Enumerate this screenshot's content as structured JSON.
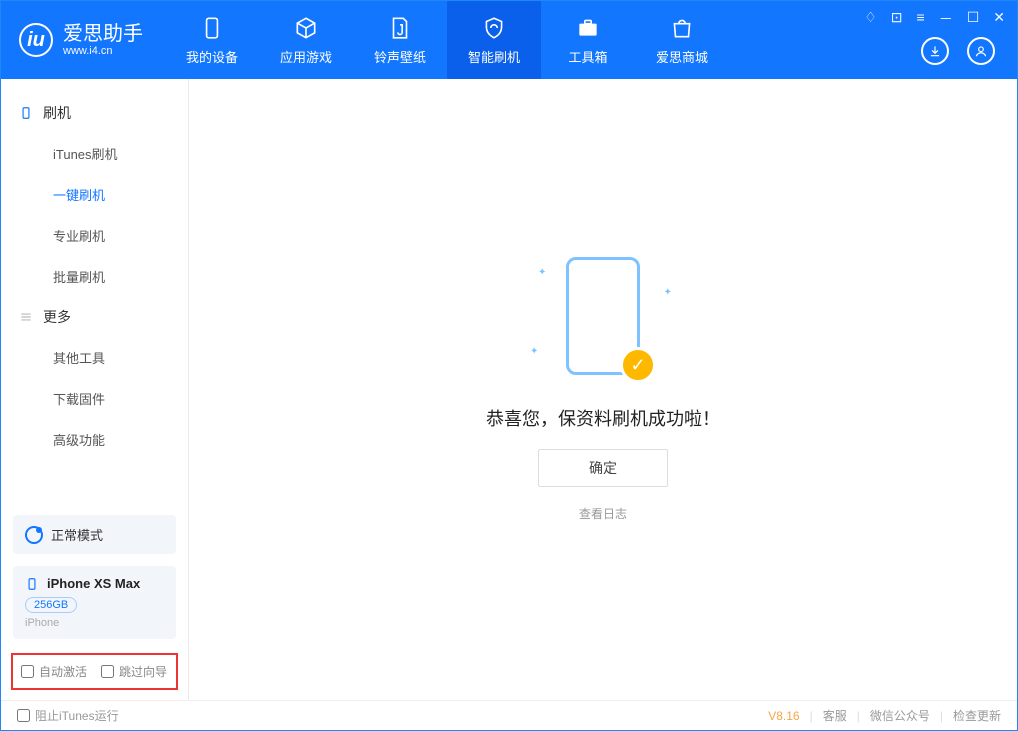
{
  "app": {
    "name": "爱思助手",
    "url": "www.i4.cn"
  },
  "nav": {
    "my_device": "我的设备",
    "apps_games": "应用游戏",
    "ringtones": "铃声壁纸",
    "smart_flash": "智能刷机",
    "toolbox": "工具箱",
    "store": "爱思商城"
  },
  "sidebar": {
    "flash_group": "刷机",
    "itunes_flash": "iTunes刷机",
    "one_key_flash": "一键刷机",
    "pro_flash": "专业刷机",
    "batch_flash": "批量刷机",
    "more_group": "更多",
    "other_tools": "其他工具",
    "download_firmware": "下载固件",
    "advanced": "高级功能",
    "mode": "正常模式",
    "device": {
      "name": "iPhone XS Max",
      "storage": "256GB",
      "type": "iPhone"
    },
    "auto_activate": "自动激活",
    "skip_guide": "跳过向导"
  },
  "main": {
    "success_msg": "恭喜您，保资料刷机成功啦！",
    "ok_button": "确定",
    "view_log": "查看日志"
  },
  "footer": {
    "block_itunes": "阻止iTunes运行",
    "version": "V8.16",
    "customer_service": "客服",
    "wechat": "微信公众号",
    "check_update": "检查更新"
  }
}
